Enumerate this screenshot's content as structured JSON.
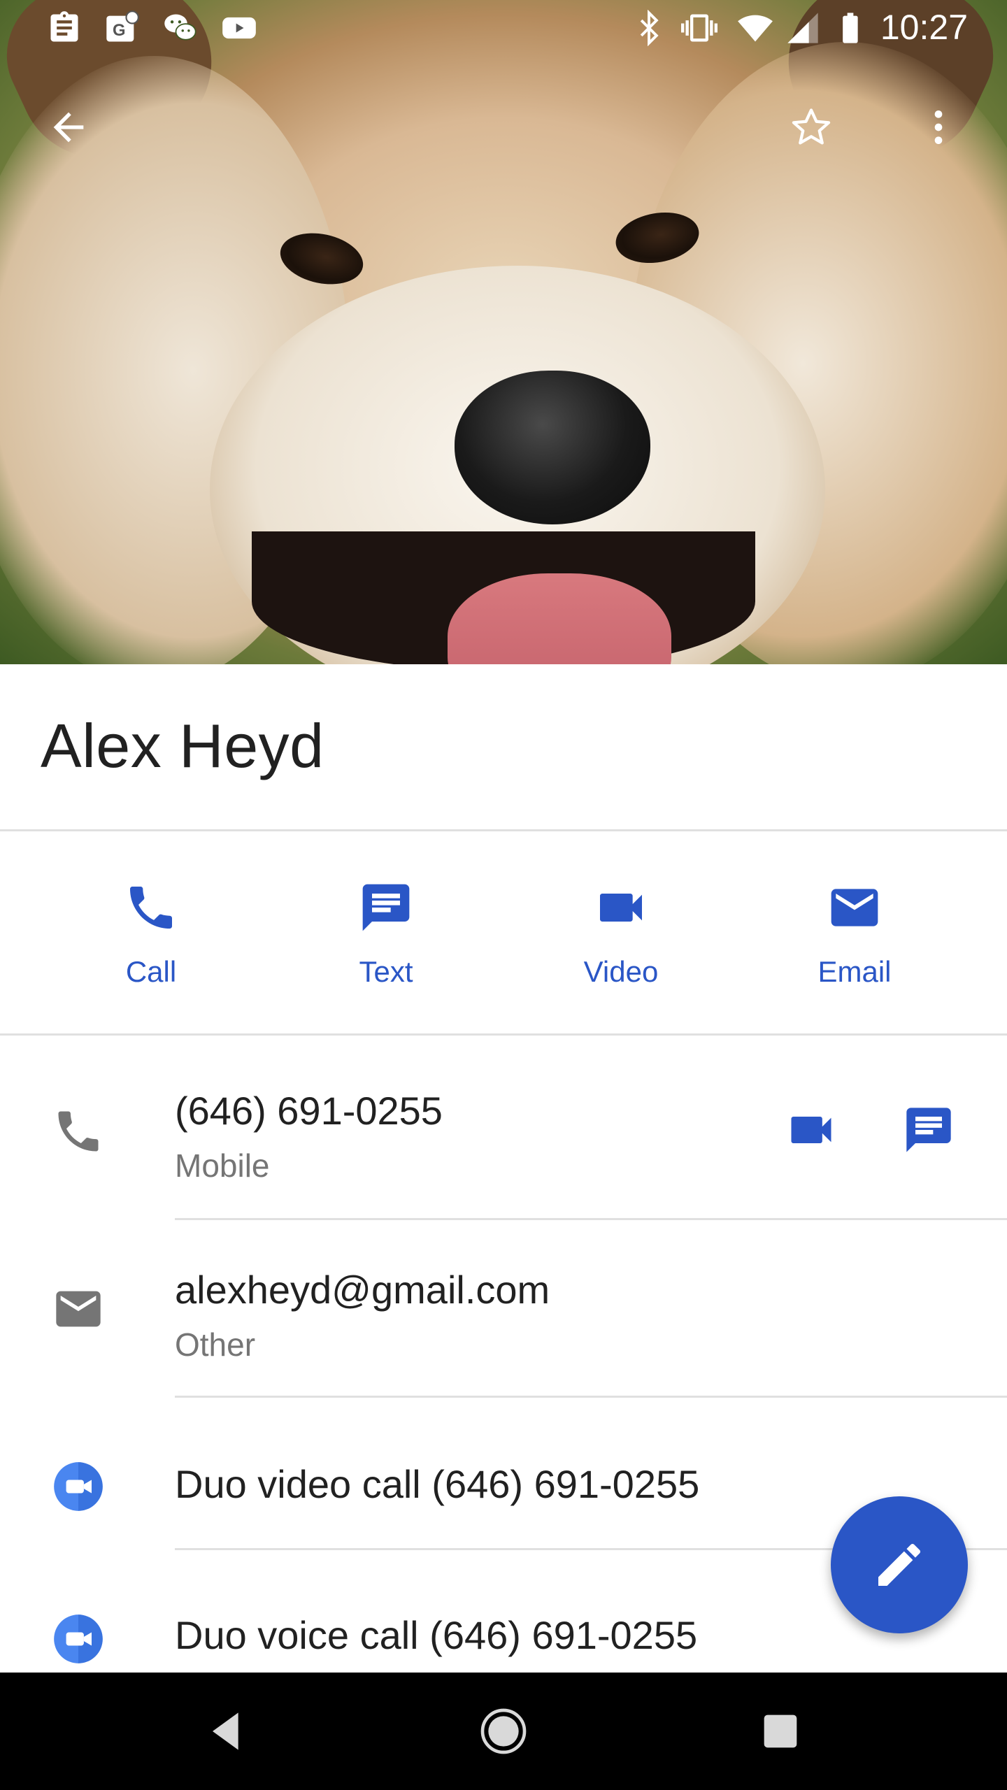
{
  "status_bar": {
    "time": "10:27",
    "left_icons": [
      "clipboard-icon",
      "maps-g-icon",
      "wechat-icon",
      "youtube-icon"
    ],
    "right_icons": [
      "bluetooth-icon",
      "vibrate-icon",
      "wifi-icon",
      "signal-icon",
      "battery-icon"
    ]
  },
  "app_bar": {
    "back_icon": "arrow-back-icon",
    "favorite_icon": "star-outline-icon",
    "more_icon": "more-vert-icon"
  },
  "contact": {
    "name": "Alex Heyd"
  },
  "actions": [
    {
      "label": "Call",
      "icon": "phone-icon"
    },
    {
      "label": "Text",
      "icon": "message-icon"
    },
    {
      "label": "Video",
      "icon": "videocam-icon"
    },
    {
      "label": "Email",
      "icon": "email-icon"
    }
  ],
  "details": {
    "phone": {
      "value": "(646) 691-0255",
      "type": "Mobile"
    },
    "email": {
      "value": "alexheyd@gmail.com",
      "type": "Other"
    },
    "duo_video": {
      "label": "Duo video call (646) 691-0255"
    },
    "duo_voice": {
      "label": "Duo voice call (646) 691-0255"
    }
  },
  "colors": {
    "accent": "#2a56c6",
    "icon_grey": "#757575",
    "duo_blue": "#4a86f0"
  },
  "fab": {
    "icon": "edit-icon"
  },
  "nav_bar": {
    "icons": [
      "nav-back-icon",
      "nav-home-icon",
      "nav-recents-icon"
    ]
  }
}
